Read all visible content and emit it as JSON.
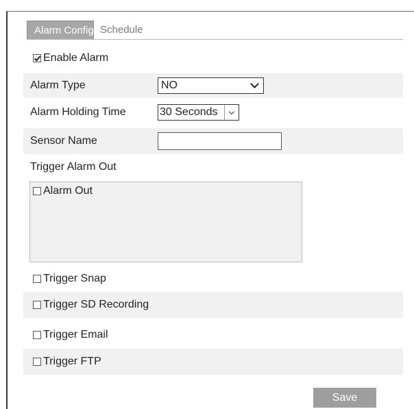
{
  "tabs": [
    {
      "label": "Alarm Config",
      "active": true
    },
    {
      "label": "Schedule",
      "active": false
    }
  ],
  "enable_alarm": {
    "label": "Enable Alarm",
    "checked": true
  },
  "alarm_type": {
    "label": "Alarm Type",
    "value": "NO"
  },
  "alarm_holding_time": {
    "label": "Alarm Holding Time",
    "value": "30 Seconds"
  },
  "sensor_name": {
    "label": "Sensor Name",
    "value": ""
  },
  "trigger_alarm_out": {
    "label": "Trigger Alarm Out",
    "alarm_out": {
      "label": "Alarm Out",
      "checked": false
    }
  },
  "trigger_snap": {
    "label": "Trigger Snap",
    "checked": false
  },
  "trigger_sd_recording": {
    "label": "Trigger SD Recording",
    "checked": false
  },
  "trigger_email": {
    "label": "Trigger Email",
    "checked": false
  },
  "trigger_ftp": {
    "label": "Trigger FTP",
    "checked": false
  },
  "save_label": "Save",
  "icons": {
    "dropdown": "chevron-down-icon",
    "checkbox": "checkbox-icon"
  },
  "colors": {
    "tab_active_bg": "#a7a7a7",
    "row_shade": "#f1f1f1",
    "save_bg": "#9e9e9e"
  }
}
